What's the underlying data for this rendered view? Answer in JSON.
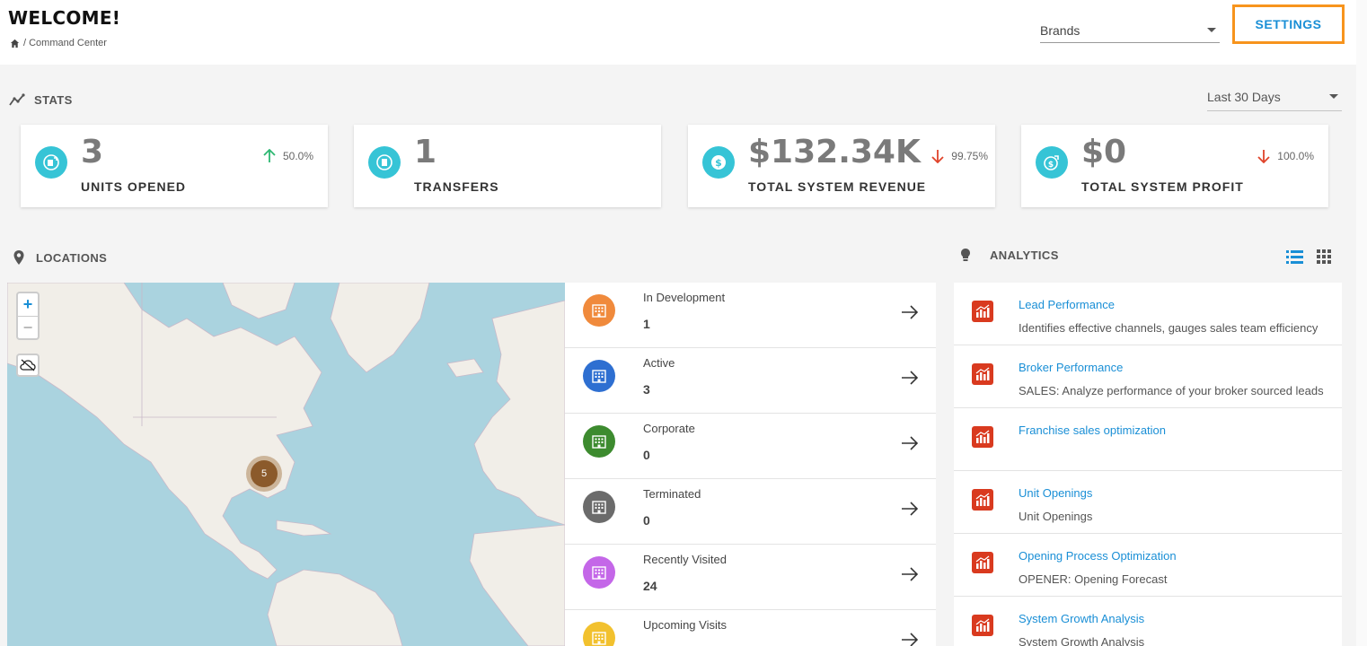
{
  "header": {
    "title": "WELCOME!",
    "breadcrumb": "/ Command Center",
    "brands_value": "Brands",
    "settings_label": "SETTINGS"
  },
  "stats": {
    "section_title": "STATS",
    "period_value": "Last 30 Days",
    "cards": [
      {
        "value": "3",
        "label": "UNITS OPENED",
        "change": "50.0%",
        "direction": "up",
        "icon": "units-opened-icon"
      },
      {
        "value": "1",
        "label": "TRANSFERS",
        "change": "",
        "direction": "none",
        "icon": "transfers-icon"
      },
      {
        "value": "$132.34K",
        "label": "TOTAL SYSTEM REVENUE",
        "change": "99.75%",
        "direction": "down",
        "icon": "dollar-icon"
      },
      {
        "value": "$0",
        "label": "TOTAL SYSTEM PROFIT",
        "change": "100.0%",
        "direction": "down",
        "icon": "profit-icon"
      }
    ]
  },
  "locations": {
    "section_title": "LOCATIONS",
    "map": {
      "cluster_count": "5",
      "zoom_in": "+",
      "zoom_out": "−"
    },
    "items": [
      {
        "name": "In Development",
        "count": "1",
        "color": "#f08a3c"
      },
      {
        "name": "Active",
        "count": "3",
        "color": "#2e6fd1"
      },
      {
        "name": "Corporate",
        "count": "0",
        "color": "#3d8b2f"
      },
      {
        "name": "Terminated",
        "count": "0",
        "color": "#6b6b6b"
      },
      {
        "name": "Recently Visited",
        "count": "24",
        "color": "#c467e8"
      },
      {
        "name": "Upcoming Visits",
        "count": "",
        "color": "#f2c12e"
      }
    ]
  },
  "analytics": {
    "section_title": "ANALYTICS",
    "items": [
      {
        "title": "Lead Performance",
        "desc": "Identifies effective channels, gauges sales team efficiency"
      },
      {
        "title": "Broker Performance",
        "desc": "SALES: Analyze performance of your broker sourced leads"
      },
      {
        "title": "Franchise sales optimization",
        "desc": ""
      },
      {
        "title": "Unit Openings",
        "desc": "Unit Openings"
      },
      {
        "title": "Opening Process Optimization",
        "desc": "OPENER: Opening Forecast"
      },
      {
        "title": "System Growth Analysis",
        "desc": "System Growth Analysis"
      }
    ]
  },
  "colors": {
    "accent": "#1a8fd6",
    "settings_border": "#f7941d",
    "stat_icon": "#36c4d6",
    "up": "#2eb872",
    "down": "#e0442b",
    "analytics_icon": "#d93a1f"
  }
}
